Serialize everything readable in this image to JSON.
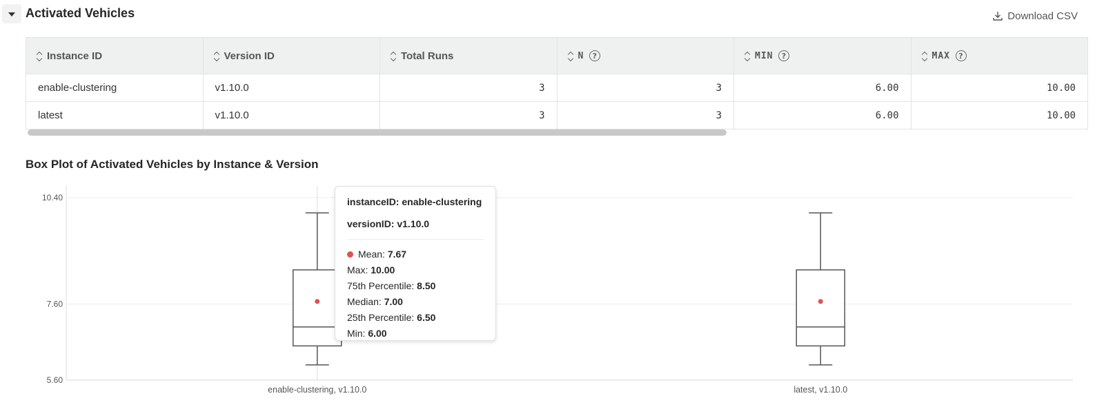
{
  "header": {
    "title": "Activated Vehicles",
    "download_label": "Download CSV"
  },
  "table": {
    "columns": [
      "Instance ID",
      "Version ID",
      "Total Runs",
      "N",
      "MIN",
      "MAX"
    ],
    "rows": [
      [
        "enable-clustering",
        "v1.10.0",
        "3",
        "3",
        "6.00",
        "10.00"
      ],
      [
        "latest",
        "v1.10.0",
        "3",
        "3",
        "6.00",
        "10.00"
      ]
    ]
  },
  "chart": {
    "title": "Box Plot of Activated Vehicles by Instance & Version"
  },
  "chart_data": {
    "type": "box",
    "title": "Box Plot of Activated Vehicles by Instance & Version",
    "xlabel": "",
    "ylabel": "",
    "ylim": [
      5.6,
      10.4
    ],
    "yticks": [
      "5.60",
      "7.60",
      "10.40"
    ],
    "categories": [
      "enable-clustering, v1.10.0",
      "latest, v1.10.0"
    ],
    "boxes": [
      {
        "min": 6.0,
        "q1": 6.5,
        "median": 7.0,
        "q3": 8.5,
        "max": 10.0,
        "mean": 7.67
      },
      {
        "min": 6.0,
        "q1": 6.5,
        "median": 7.0,
        "q3": 8.5,
        "max": 10.0,
        "mean": 7.67
      }
    ],
    "colors": {
      "box": "#555555",
      "mean": "#e05252",
      "grid": "#ececec"
    }
  },
  "tooltip": {
    "instance": "instanceID: enable-clustering",
    "version": "versionID: v1.10.0",
    "mean_label": "Mean: ",
    "mean_value": "7.67",
    "max_label": "Max: ",
    "max_value": "10.00",
    "p75_label": "75th Percentile: ",
    "p75_value": "8.50",
    "median_label": "Median: ",
    "median_value": "7.00",
    "p25_label": "25th Percentile: ",
    "p25_value": "6.50",
    "min_label": "Min: ",
    "min_value": "6.00"
  }
}
